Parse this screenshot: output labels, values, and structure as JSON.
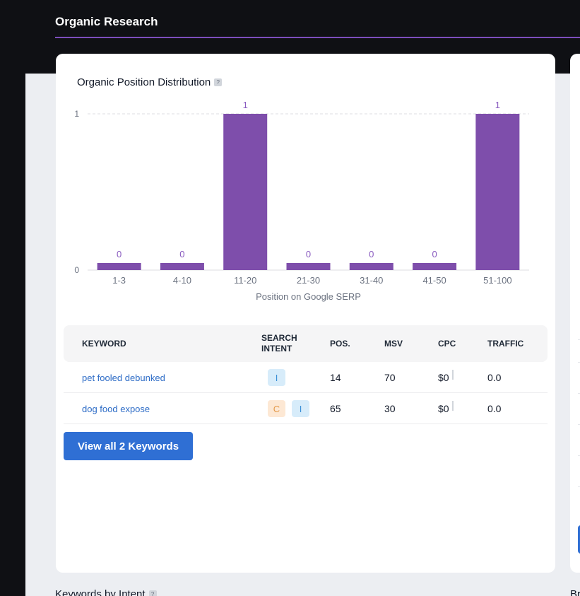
{
  "header": {
    "title": "Organic Research"
  },
  "card": {
    "title": "Organic Position Distribution",
    "help_icon": "?"
  },
  "chart_data": {
    "type": "bar",
    "categories": [
      "1-3",
      "4-10",
      "11-20",
      "21-30",
      "31-40",
      "41-50",
      "51-100"
    ],
    "values": [
      0,
      0,
      1,
      0,
      0,
      0,
      1
    ],
    "data_labels": [
      "0",
      "0",
      "1",
      "0",
      "0",
      "0",
      "1"
    ],
    "xlabel": "Position on Google SERP",
    "ylabel": "",
    "ylim": [
      0,
      1
    ],
    "yticks": [
      "0",
      "1"
    ],
    "grid": true,
    "color": "#7e4eab"
  },
  "table": {
    "headers": {
      "keyword": "KEYWORD",
      "intent_line1": "SEARCH",
      "intent_line2": "INTENT",
      "pos": "POS.",
      "msv": "MSV",
      "cpc": "CPC",
      "traffic": "TRAFFIC"
    },
    "rows": [
      {
        "keyword": "pet fooled debunked",
        "intents": [
          "I"
        ],
        "pos": "14",
        "msv": "70",
        "cpc": "$0",
        "traffic": "0.0"
      },
      {
        "keyword": "dog food expose",
        "intents": [
          "C",
          "I"
        ],
        "pos": "65",
        "msv": "30",
        "cpc": "$0",
        "traffic": "0.0"
      }
    ]
  },
  "view_all_button": "View all 2 Keywords",
  "bottom": {
    "left_title": "Keywords by Intent",
    "right_title": "Br"
  },
  "colors": {
    "accent": "#7c4dbc",
    "button": "#2f6fd4",
    "bar": "#7e4eab",
    "link": "#2c6bc6"
  }
}
